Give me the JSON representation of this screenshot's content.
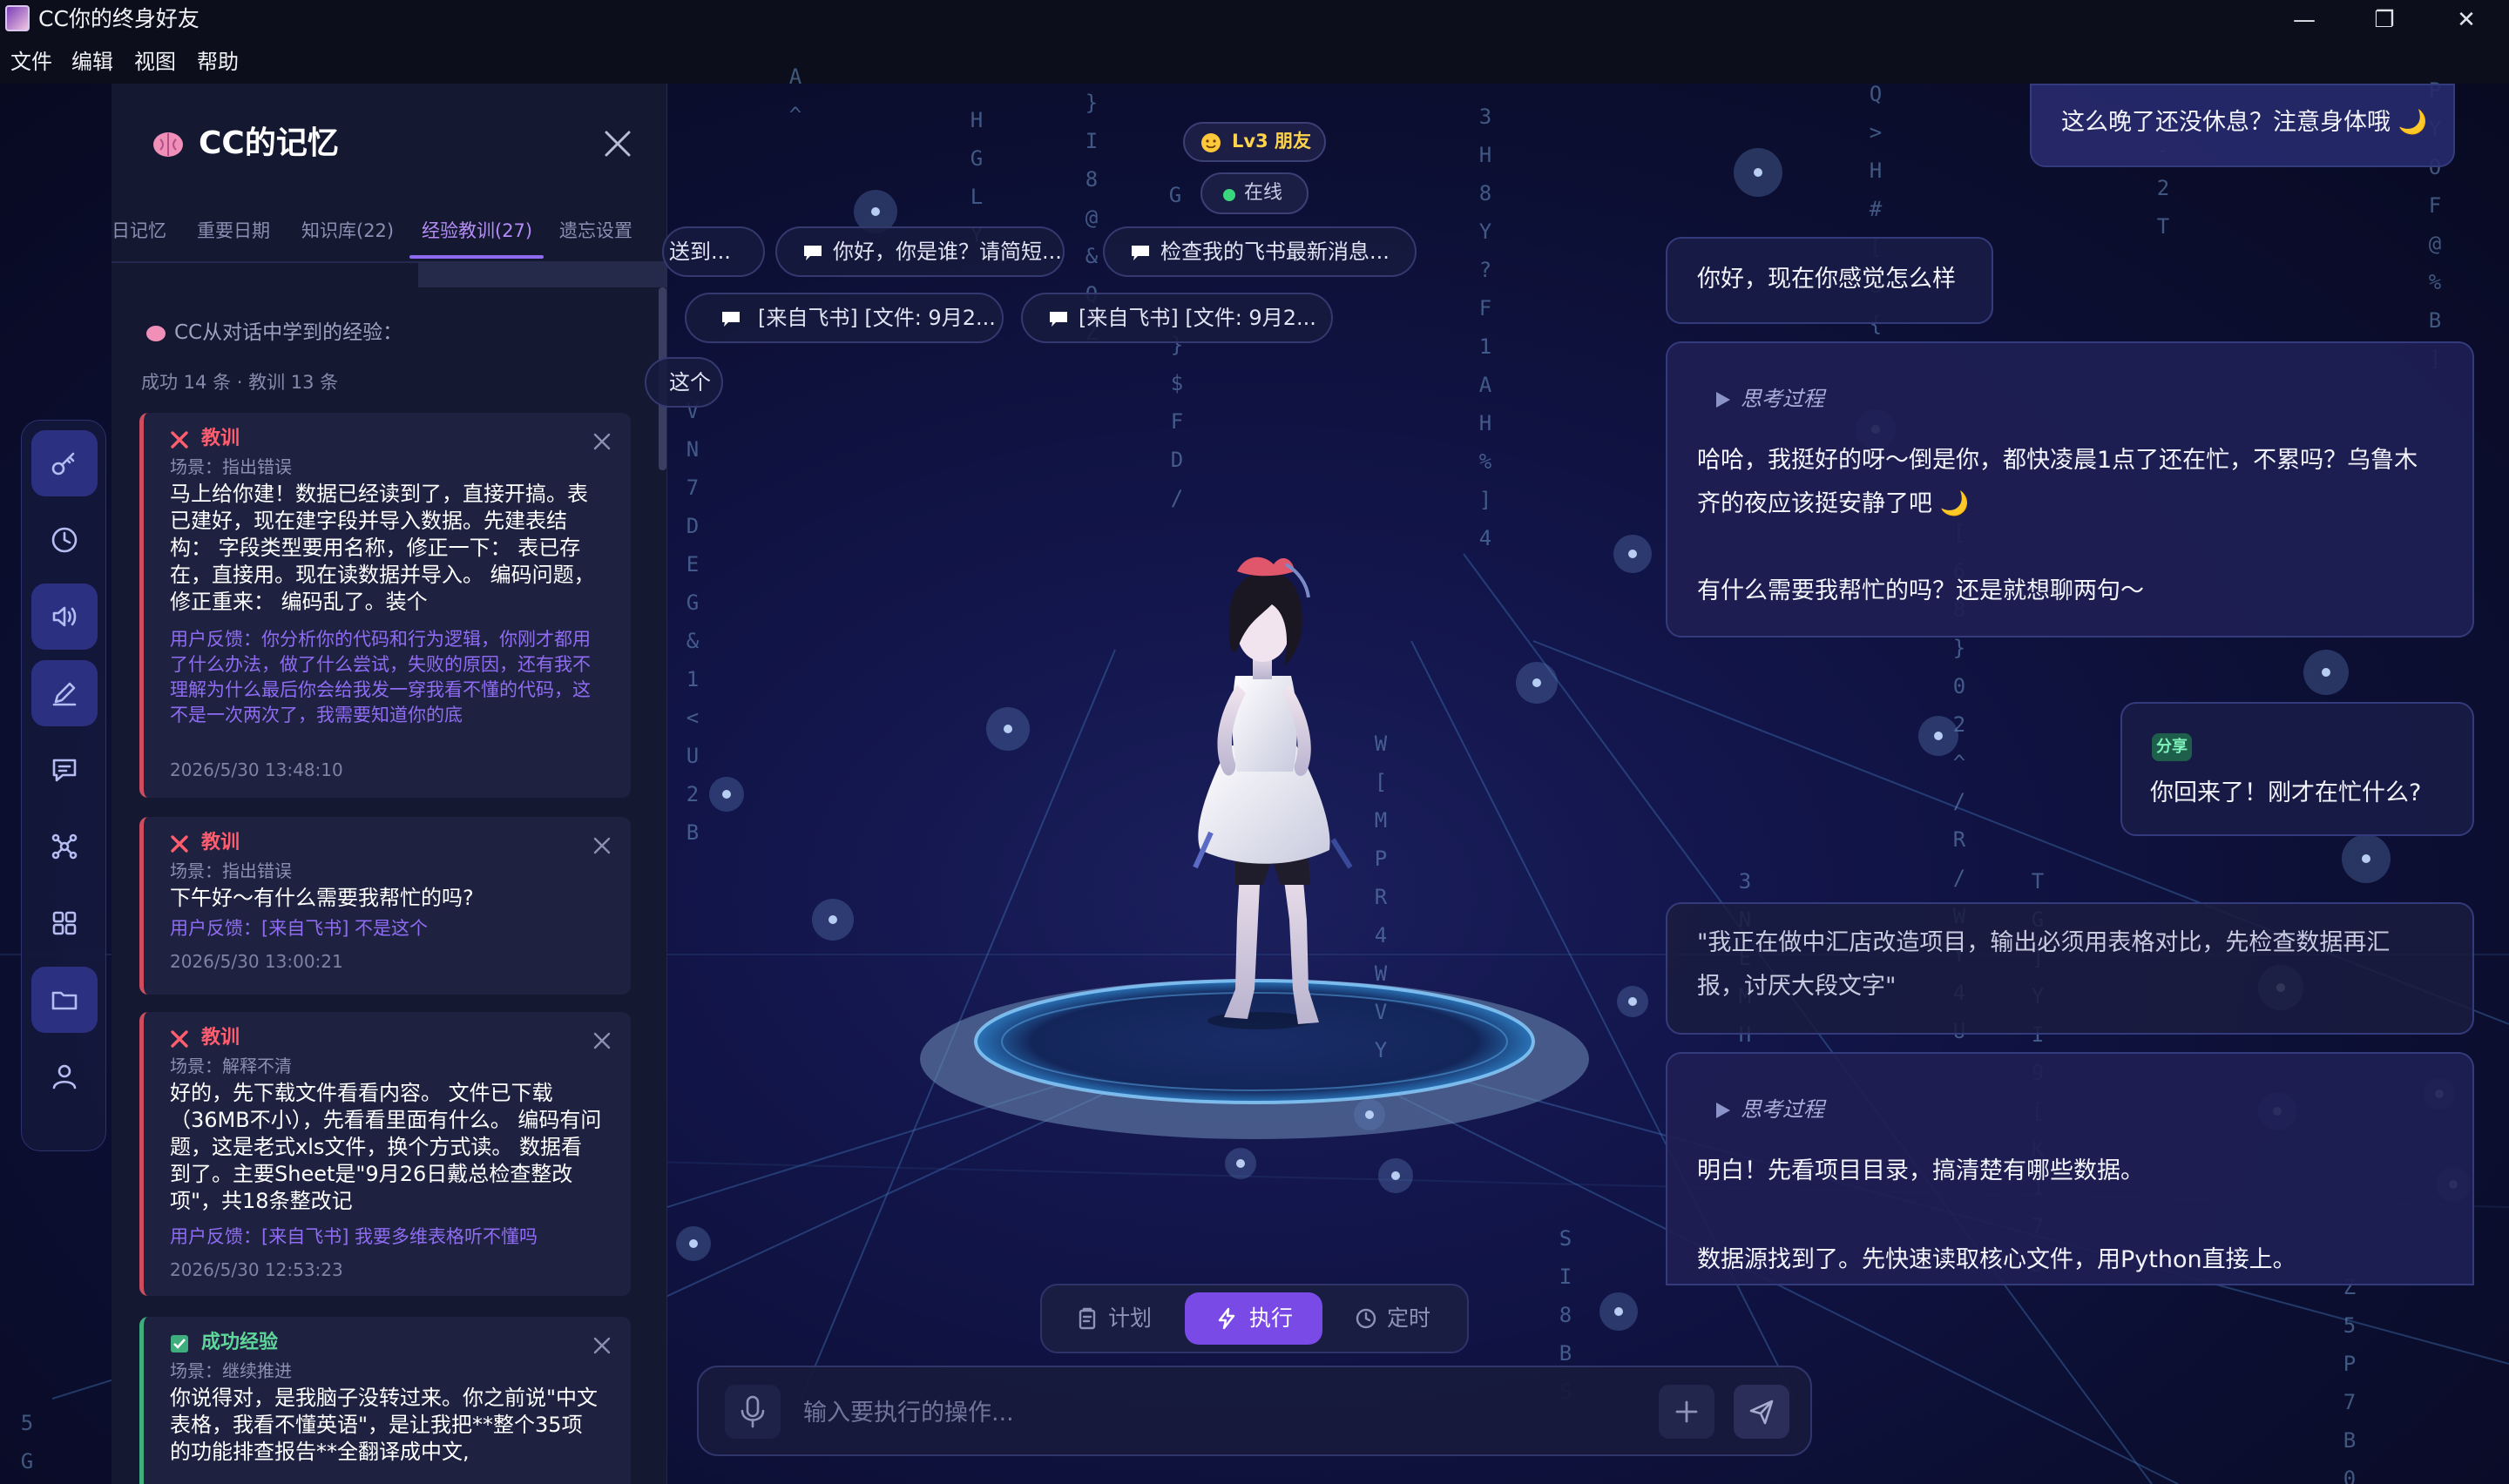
{
  "window": {
    "title": "CC你的终身好友",
    "minimize_glyph": "—",
    "maximize_glyph": "❐",
    "close_glyph": "✕"
  },
  "menu": [
    "文件",
    "编辑",
    "视图",
    "帮助"
  ],
  "status": {
    "level": "Lv3 朋友",
    "online": "在线"
  },
  "memory_panel": {
    "title": "CC的记忆",
    "tabs": [
      "日记忆",
      "重要日期",
      "知识库(22)",
      "经验教训(27)",
      "遗忘设置"
    ],
    "active_tab": "经验教训(27)",
    "subtitle": "CC从对话中学到的经验：",
    "stats": "成功 14 条 · 教训 13 条",
    "cards": [
      {
        "type": "教训",
        "scene": "场景：指出错误",
        "text": "马上给你建！数据已经读到了，直接开搞。表已建好，现在建字段并导入数据。先建表结构： 字段类型要用名称，修正一下： 表已存在，直接用。现在读数据并导入。 编码问题，修正重来： 编码乱了。装个",
        "feedback": "用户反馈：你分析你的代码和行为逻辑，你刚才都用了什么办法，做了什么尝试，失败的原因，还有我不理解为什么最后你会给我发一穿我看不懂的代码，这不是一次两次了，我需要知道你的底",
        "time": "2026/5/30 13:48:10"
      },
      {
        "type": "教训",
        "scene": "场景：指出错误",
        "text": "下午好～有什么需要我帮忙的吗?",
        "feedback": "用户反馈：[来自飞书] 不是这个",
        "time": "2026/5/30 13:00:21"
      },
      {
        "type": "教训",
        "scene": "场景：解释不清",
        "text": "好的，先下载文件看看内容。 文件已下载（36MB不小），先看看里面有什么。 编码有问题，这是老式xls文件，换个方式读。 数据看到了。主要Sheet是\"9月26日戴总检查整改项\"，共18条整改记",
        "feedback": "用户反馈：[来自飞书] 我要多维表格听不懂吗",
        "time": "2026/5/30 12:53:23"
      },
      {
        "type": "成功经验",
        "scene": "场景：继续推进",
        "text": "你说得对，是我脑子没转过来。你之前说\"中文表格，我看不懂英语\"，是让我把**整个35项的功能排查报告**全翻译成中文,",
        "feedback": "",
        "time": ""
      }
    ]
  },
  "quick_chips": [
    "送到...",
    "你好，你是谁？请简短...",
    "检查我的飞书最新消息...",
    "[来自飞书] [文件: 9月2...",
    "[来自飞书] [文件: 9月2...",
    "这个"
  ],
  "chat": {
    "m1": "这么晚了还没休息？注意身体哦 🌙",
    "m2": "你好，现在你感觉怎么样",
    "think_label": "思考过程",
    "m3_line1": "哈哈，我挺好的呀～倒是你，都快凌晨1点了还在忙，不累吗？乌鲁木",
    "m3_line2": "齐的夜应该挺安静了吧 🌙",
    "m3_line3": "有什么需要我帮忙的吗？还是就想聊两句～",
    "share_tag": "分享",
    "m4": "你回来了！刚才在忙什么?",
    "m5_line1": "\"我正在做中汇店改造项目，输出必须用表格对比，先检查数据再汇",
    "m5_line2": "报，讨厌大段文字\"",
    "m6_line1": "明白！先看项目目录，搞清楚有哪些数据。",
    "m6_line2": "数据源找到了。先快速读取核心文件，用Python直接上。"
  },
  "modes": [
    "计划",
    "执行",
    "定时"
  ],
  "active_mode": "执行",
  "input": {
    "placeholder": "输入要执行的操作...",
    "value": ""
  },
  "colors": {
    "accent": "#7a4ae6",
    "online": "#39d77d",
    "lesson": "#ff5e6e",
    "success": "#5ed69a",
    "background": "#0b0e26"
  },
  "icons": {
    "rail": [
      "key-icon",
      "clock-icon",
      "speaker-icon",
      "pen-icon",
      "chat-icon",
      "network-icon",
      "grid-icon",
      "folder-icon",
      "user-icon"
    ]
  },
  "rain_columns": [
    "A ^",
    "H G L Y",
    "} I 8 @ & Q Z",
    "G",
    "} $ F D /",
    "3 H 8 Y ? F 1 A H % ] 4",
    "Q > H # [ U {",
    "V N 7 D E G & 1 < U 2 B",
    "W [ M P R 4 W V Y",
    "[ 6 8 } 0 2 ^ / R / W Y 4 U",
    "3 N E M H",
    "T G ] Y I 9 [ K 1 7 J",
    "- 2 T",
    "P Y O F @ % B ]",
    "S I 8 B S",
    "Z 5 P 7 B 0",
    "5 G"
  ]
}
